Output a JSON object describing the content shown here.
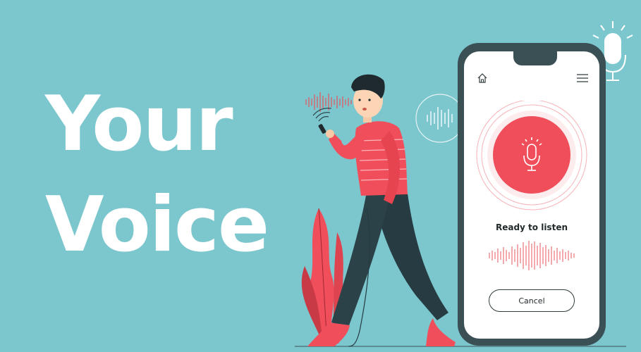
{
  "headline": {
    "line1": "Your",
    "line2": "Voice"
  },
  "phone": {
    "status_text": "Ready to listen",
    "cancel_label": "Cancel"
  },
  "colors": {
    "background": "#7cc6cd",
    "accent_red": "#f04e5a",
    "dark": "#3b5055",
    "white": "#ffffff"
  },
  "icons": [
    "home-icon",
    "menu-icon",
    "microphone-icon",
    "sound-wave-icon"
  ]
}
